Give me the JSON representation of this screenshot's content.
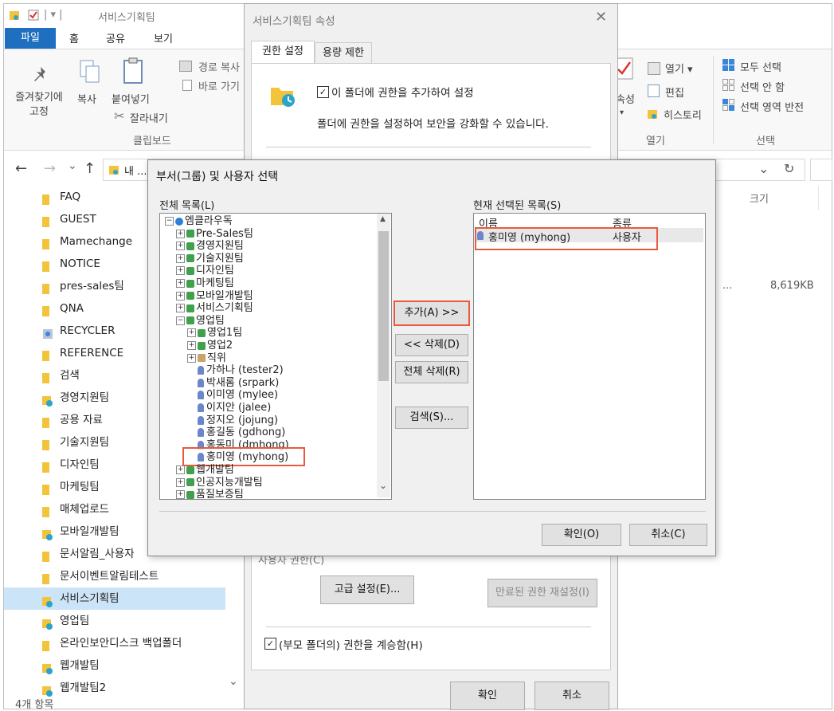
{
  "explorer": {
    "title": "서비스기획팀",
    "qat_sep": "| ▾ |",
    "tabs": [
      "파일",
      "홈",
      "공유",
      "보기"
    ],
    "ribbon": {
      "pin_label": "즐겨찾기에\n고정",
      "copy_label": "복사",
      "paste_label": "붙여넣기",
      "copy_path": "경로 복사",
      "paste_shortcut": "바로 가기",
      "cut": "잘라내기",
      "clipboard_group": "클립보드",
      "open": "열기 ▾",
      "edit": "편집",
      "history": "히스토리",
      "properties_frag": "속성",
      "open_group": "열기",
      "select_all": "모두 선택",
      "select_none": "선택 안 함",
      "invert_select": "선택 영역 반전",
      "select_group": "선택"
    },
    "address": {
      "back": "←",
      "forward": "→",
      "down": "⌄",
      "up": "↑",
      "path_frag": "내 ...",
      "dropdown": "⌄",
      "refresh": "↻"
    },
    "column_size": "크기",
    "file_size": "8,619KB",
    "file_ellipsis": "...",
    "nav_items": [
      {
        "label": "FAQ",
        "type": "folder"
      },
      {
        "label": "GUEST",
        "type": "folder"
      },
      {
        "label": "Mamechange",
        "type": "folder"
      },
      {
        "label": "NOTICE",
        "type": "folder"
      },
      {
        "label": "pres-sales팀",
        "type": "folder"
      },
      {
        "label": "QNA",
        "type": "folder"
      },
      {
        "label": "RECYCLER",
        "type": "recycler"
      },
      {
        "label": "REFERENCE",
        "type": "folder"
      },
      {
        "label": "검색",
        "type": "folder"
      },
      {
        "label": "경영지원팀",
        "type": "shared"
      },
      {
        "label": "공용 자료",
        "type": "folder"
      },
      {
        "label": "기술지원팀",
        "type": "folder"
      },
      {
        "label": "디자인팀",
        "type": "folder"
      },
      {
        "label": "마케팅팀",
        "type": "folder"
      },
      {
        "label": "매체업로드",
        "type": "folder"
      },
      {
        "label": "모바일개발팀",
        "type": "shared"
      },
      {
        "label": "문서알림_사용자",
        "type": "folder"
      },
      {
        "label": "문서이벤트알림테스트",
        "type": "folder"
      },
      {
        "label": "서비스기획팀",
        "type": "shared",
        "selected": true
      },
      {
        "label": "영업팀",
        "type": "shared"
      },
      {
        "label": "온라인보안디스크 백업폴더",
        "type": "folder"
      },
      {
        "label": "웹개발팀",
        "type": "shared"
      },
      {
        "label": "웹개발팀2",
        "type": "shared"
      }
    ],
    "status": "4개 항목"
  },
  "props_dialog": {
    "title": "서비스기획팀 속성",
    "close": "✕",
    "tabs": [
      "권한 설정",
      "용량 제한"
    ],
    "add_permission_check": "✓",
    "add_permission_label": "이 폴더에 권한을 추가하여 설정",
    "description": "폴더에 권한을 설정하여 보안을 강화할 수 있습니다.",
    "partial_label": "사용자 권한(C)",
    "advanced_button": "고급 설정(E)...",
    "reset_expired_button": "만료된 권한 재설정(I)",
    "inherit_check": "✓",
    "inherit_label": "(부모 폴더의) 권한을 계승함(H)",
    "ok": "확인",
    "cancel": "취소"
  },
  "select_dialog": {
    "title": "부서(그룹) 및 사용자 선택",
    "all_list_label": "전체 목록(L)",
    "selected_list_label": "현재 선택된 목록(S)",
    "tree": [
      {
        "indent": 0,
        "toggle": "⊟",
        "icon": "org",
        "label": "엠클라우독"
      },
      {
        "indent": 1,
        "toggle": "⊞",
        "icon": "group",
        "label": "Pre-Sales팀"
      },
      {
        "indent": 1,
        "toggle": "⊞",
        "icon": "group",
        "label": "경영지원팀"
      },
      {
        "indent": 1,
        "toggle": "⊞",
        "icon": "group",
        "label": "기술지원팀"
      },
      {
        "indent": 1,
        "toggle": "⊞",
        "icon": "group",
        "label": "디자인팀"
      },
      {
        "indent": 1,
        "toggle": "⊞",
        "icon": "group",
        "label": "마케팅팀"
      },
      {
        "indent": 1,
        "toggle": "⊞",
        "icon": "group",
        "label": "모바일개발팀"
      },
      {
        "indent": 1,
        "toggle": "⊞",
        "icon": "group",
        "label": "서비스기획팀"
      },
      {
        "indent": 1,
        "toggle": "⊟",
        "icon": "group",
        "label": "영업팀"
      },
      {
        "indent": 2,
        "toggle": "⊞",
        "icon": "group",
        "label": "영업1팀"
      },
      {
        "indent": 2,
        "toggle": "⊞",
        "icon": "group",
        "label": "영업2"
      },
      {
        "indent": 2,
        "toggle": "⊞",
        "icon": "position",
        "label": "직위"
      },
      {
        "indent": 2,
        "toggle": "",
        "icon": "user",
        "label": "가하나 (tester2)"
      },
      {
        "indent": 2,
        "toggle": "",
        "icon": "user",
        "label": "박새롬 (srpark)"
      },
      {
        "indent": 2,
        "toggle": "",
        "icon": "user",
        "label": "이미영 (mylee)"
      },
      {
        "indent": 2,
        "toggle": "",
        "icon": "user",
        "label": "이지안 (jalee)"
      },
      {
        "indent": 2,
        "toggle": "",
        "icon": "user",
        "label": "정지오 (jojung)"
      },
      {
        "indent": 2,
        "toggle": "",
        "icon": "user",
        "label": "홍길동 (gdhong)"
      },
      {
        "indent": 2,
        "toggle": "",
        "icon": "user",
        "label": "홍동미 (dmhong)"
      },
      {
        "indent": 2,
        "toggle": "",
        "icon": "user",
        "label": "홍미영 (myhong)",
        "highlight": true
      },
      {
        "indent": 1,
        "toggle": "⊞",
        "icon": "group",
        "label": "웹개발팀"
      },
      {
        "indent": 1,
        "toggle": "⊞",
        "icon": "group",
        "label": "인공지능개발팀"
      },
      {
        "indent": 1,
        "toggle": "⊞",
        "icon": "group",
        "label": "품질보증팀"
      }
    ],
    "scroll_up": "▲",
    "scroll_down": "⌄",
    "add_button": "추가(A) >>",
    "remove_button": "<< 삭제(D)",
    "remove_all_button": "전체 삭제(R)",
    "search_button": "검색(S)...",
    "selected_columns": [
      "이름",
      "종류"
    ],
    "selected_rows": [
      {
        "name": "홍미영 (myhong)",
        "kind": "사용자"
      }
    ],
    "ok": "확인(O)",
    "cancel": "취소(C)"
  },
  "colors": {
    "highlight": "#e95a3c",
    "file_tab": "#1f6fc1",
    "nav_selected": "#cce4f7"
  }
}
